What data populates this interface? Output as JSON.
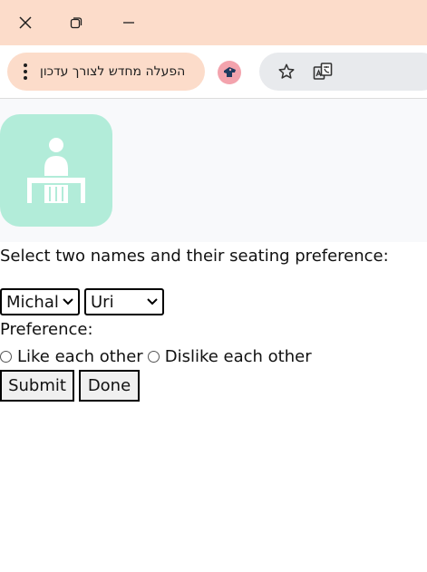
{
  "window": {
    "controls": {
      "close": "close-icon",
      "restore": "restore-icon",
      "minimize": "minimize-icon"
    }
  },
  "toolbar": {
    "update_chip_label": "הפעלה מחדש לצורך עדכון",
    "menu_icon": "more-vert-icon",
    "extension_icon": "extension-avatar-icon",
    "bookmark_icon": "star-icon",
    "translate_icon": "translate-icon"
  },
  "page": {
    "logo_icon": "person-at-desk-icon",
    "prompt": "Select two names and their seating preference:",
    "select_first": {
      "selected": "Michal"
    },
    "select_second": {
      "selected": "Uri"
    },
    "preference_label": "Preference:",
    "options": [
      {
        "label": "Like each other",
        "checked": false
      },
      {
        "label": "Dislike each other",
        "checked": false
      }
    ],
    "submit_label": "Submit",
    "done_label": "Done"
  },
  "colors": {
    "titlebar": "#fcdcca",
    "update_chip": "#fcdcca",
    "logo_tile": "#b2ecd9",
    "banner": "#f8f9fb",
    "omnibox": "#e8eaed"
  }
}
